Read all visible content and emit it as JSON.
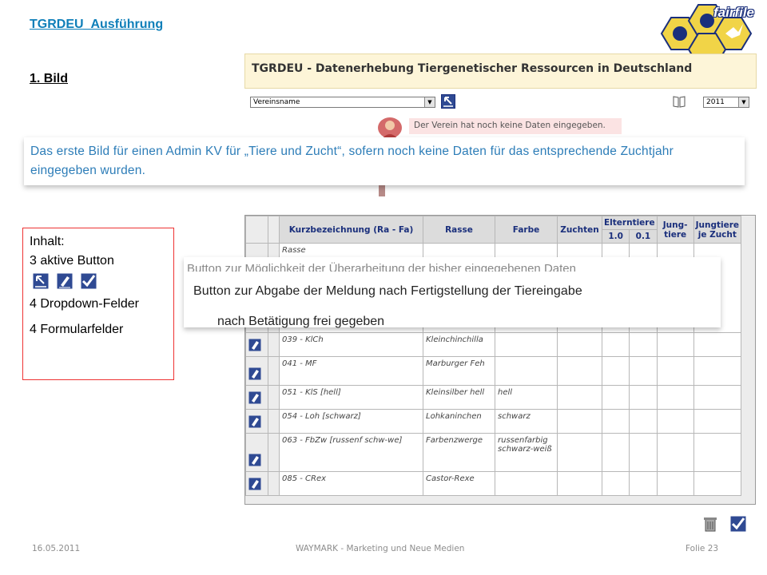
{
  "slide": {
    "link_title": "TGRDEU_Ausführung",
    "subtitle": "1. Bild",
    "logo_text": "fairfile"
  },
  "app": {
    "header_title": "TGRDEU - Datenerhebung Tiergenetischer Ressourcen in Deutschland",
    "verein_select": "Vereinsname",
    "year_select": "2011",
    "message": "Der Verein hat noch keine Daten eingegeben."
  },
  "callout_top": {
    "text": "Das erste Bild für einen Admin KV für „Tiere und Zucht“, sofern noch keine Daten für das entsprechende  Zuchtjahr eingegeben wurden."
  },
  "inhalt": {
    "heading": "Inhalt:",
    "buttons": "3 aktive Button",
    "dropdowns": "4 Dropdown-Felder",
    "fields": "4 Formularfelder"
  },
  "table": {
    "headers": {
      "kurz": "Kurzbezeichnung (Ra - Fa)",
      "rasse": "Rasse",
      "farbe": "Farbe",
      "zuchten": "Zuchten",
      "eltern": "Elterntiere",
      "e10": "1.0",
      "e01": "0.1",
      "jung": "Jung-tiere",
      "jungz": "Jungtiere je Zucht"
    },
    "first_row_partial": "Rasse",
    "rows": [
      {
        "kurz": "039 - KlCh",
        "rasse": "Kleinchinchilla",
        "farbe": ""
      },
      {
        "kurz": "041 - MF",
        "rasse": "Marburger Feh",
        "farbe": ""
      },
      {
        "kurz": "051 - KlS [hell]",
        "rasse": "Kleinsilber hell",
        "farbe": "hell"
      },
      {
        "kurz": "054 - Loh [schwarz]",
        "rasse": "Lohkaninchen",
        "farbe": "schwarz"
      },
      {
        "kurz": "063 - FbZw [russenf schw-we]",
        "rasse": "Farbenzwerge",
        "farbe": "russenfarbig schwarz-weiß"
      },
      {
        "kurz": "085 - CRex",
        "rasse": "Castor-Rexe",
        "farbe": ""
      }
    ]
  },
  "callout_main": {
    "ghost": "Button zur Möglichkeit der Überarbeitung der bisher eingegebenen Daten",
    "line1": "Button zur Abgabe der Meldung  nach Fertigstellung der Tiereingabe",
    "line2": "nach Betätigung frei gegeben"
  },
  "footer": {
    "date": "16.05.2011",
    "center": "WAYMARK - Marketing und Neue Medien",
    "page": "Folie 23"
  },
  "colors": {
    "link_blue": "#0f7fb9",
    "callout_blue_text": "#2d7db8",
    "header_bg": "#fdf5d8",
    "message_bg": "#fbe3e3",
    "table_header_text": "#1a2f7c",
    "inhalt_border": "#ee3333"
  }
}
